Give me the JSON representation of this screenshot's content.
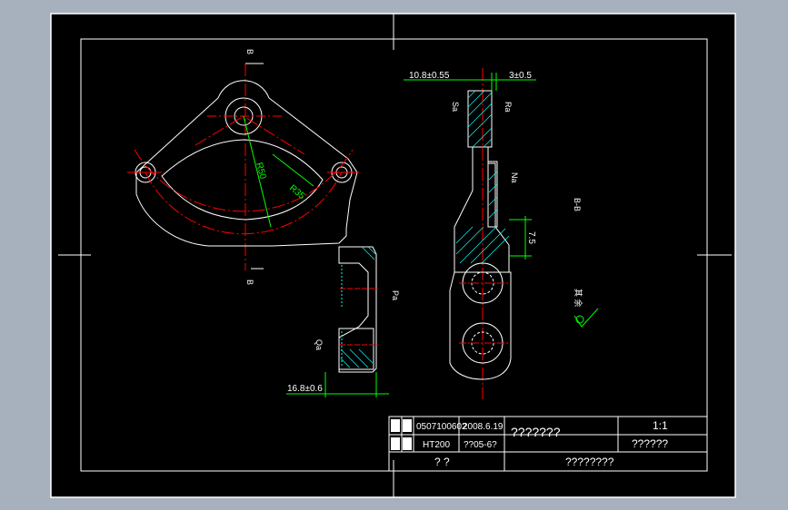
{
  "drawing": {
    "colors": {
      "background": "#000000",
      "frame": "#ffffff",
      "outline": "#ffffff",
      "centerline": "#ff0000",
      "dimension": "#00ff00",
      "hatch": "#00ffff",
      "viewport_bg": "#a7b1be"
    },
    "section_labels": {
      "top_b": "B",
      "bottom_b": "B",
      "section_name": "B-B"
    },
    "dimensions": {
      "radius_big": "R50",
      "radius_small": "R35",
      "front_width": "10.8±0.55",
      "front_right": "3±0.5",
      "front_step": "7.5",
      "left_width": "16.8±0.6",
      "surface_r": "Ra",
      "surface_s": "Sa",
      "surface_n": "Na",
      "surface_p": "Pa",
      "surface_q": "Qa"
    },
    "roughness_note": "其 余"
  },
  "title_block": {
    "row1_label": "制图",
    "row1_id": "0507100602",
    "row1_date": "2008.6.19",
    "row2_label": "校核",
    "row2_material": "HT200",
    "row2_code": "??05-6?",
    "part_name": "???????",
    "scale": "1:1",
    "org": "??????",
    "bottom_left": "? ?",
    "drawing_no": "????????"
  }
}
